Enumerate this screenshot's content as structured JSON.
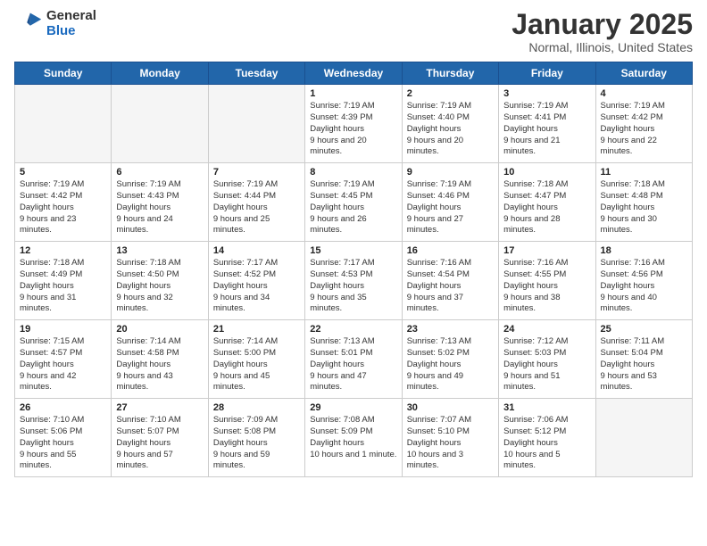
{
  "logo": {
    "general": "General",
    "blue": "Blue"
  },
  "header": {
    "title": "January 2025",
    "subtitle": "Normal, Illinois, United States"
  },
  "days_of_week": [
    "Sunday",
    "Monday",
    "Tuesday",
    "Wednesday",
    "Thursday",
    "Friday",
    "Saturday"
  ],
  "weeks": [
    [
      {
        "day": "",
        "empty": true
      },
      {
        "day": "",
        "empty": true
      },
      {
        "day": "",
        "empty": true
      },
      {
        "day": "1",
        "sunrise": "7:19 AM",
        "sunset": "4:39 PM",
        "daylight": "9 hours and 20 minutes."
      },
      {
        "day": "2",
        "sunrise": "7:19 AM",
        "sunset": "4:40 PM",
        "daylight": "9 hours and 20 minutes."
      },
      {
        "day": "3",
        "sunrise": "7:19 AM",
        "sunset": "4:41 PM",
        "daylight": "9 hours and 21 minutes."
      },
      {
        "day": "4",
        "sunrise": "7:19 AM",
        "sunset": "4:42 PM",
        "daylight": "9 hours and 22 minutes."
      }
    ],
    [
      {
        "day": "5",
        "sunrise": "7:19 AM",
        "sunset": "4:42 PM",
        "daylight": "9 hours and 23 minutes."
      },
      {
        "day": "6",
        "sunrise": "7:19 AM",
        "sunset": "4:43 PM",
        "daylight": "9 hours and 24 minutes."
      },
      {
        "day": "7",
        "sunrise": "7:19 AM",
        "sunset": "4:44 PM",
        "daylight": "9 hours and 25 minutes."
      },
      {
        "day": "8",
        "sunrise": "7:19 AM",
        "sunset": "4:45 PM",
        "daylight": "9 hours and 26 minutes."
      },
      {
        "day": "9",
        "sunrise": "7:19 AM",
        "sunset": "4:46 PM",
        "daylight": "9 hours and 27 minutes."
      },
      {
        "day": "10",
        "sunrise": "7:18 AM",
        "sunset": "4:47 PM",
        "daylight": "9 hours and 28 minutes."
      },
      {
        "day": "11",
        "sunrise": "7:18 AM",
        "sunset": "4:48 PM",
        "daylight": "9 hours and 30 minutes."
      }
    ],
    [
      {
        "day": "12",
        "sunrise": "7:18 AM",
        "sunset": "4:49 PM",
        "daylight": "9 hours and 31 minutes."
      },
      {
        "day": "13",
        "sunrise": "7:18 AM",
        "sunset": "4:50 PM",
        "daylight": "9 hours and 32 minutes."
      },
      {
        "day": "14",
        "sunrise": "7:17 AM",
        "sunset": "4:52 PM",
        "daylight": "9 hours and 34 minutes."
      },
      {
        "day": "15",
        "sunrise": "7:17 AM",
        "sunset": "4:53 PM",
        "daylight": "9 hours and 35 minutes."
      },
      {
        "day": "16",
        "sunrise": "7:16 AM",
        "sunset": "4:54 PM",
        "daylight": "9 hours and 37 minutes."
      },
      {
        "day": "17",
        "sunrise": "7:16 AM",
        "sunset": "4:55 PM",
        "daylight": "9 hours and 38 minutes."
      },
      {
        "day": "18",
        "sunrise": "7:16 AM",
        "sunset": "4:56 PM",
        "daylight": "9 hours and 40 minutes."
      }
    ],
    [
      {
        "day": "19",
        "sunrise": "7:15 AM",
        "sunset": "4:57 PM",
        "daylight": "9 hours and 42 minutes."
      },
      {
        "day": "20",
        "sunrise": "7:14 AM",
        "sunset": "4:58 PM",
        "daylight": "9 hours and 43 minutes."
      },
      {
        "day": "21",
        "sunrise": "7:14 AM",
        "sunset": "5:00 PM",
        "daylight": "9 hours and 45 minutes."
      },
      {
        "day": "22",
        "sunrise": "7:13 AM",
        "sunset": "5:01 PM",
        "daylight": "9 hours and 47 minutes."
      },
      {
        "day": "23",
        "sunrise": "7:13 AM",
        "sunset": "5:02 PM",
        "daylight": "9 hours and 49 minutes."
      },
      {
        "day": "24",
        "sunrise": "7:12 AM",
        "sunset": "5:03 PM",
        "daylight": "9 hours and 51 minutes."
      },
      {
        "day": "25",
        "sunrise": "7:11 AM",
        "sunset": "5:04 PM",
        "daylight": "9 hours and 53 minutes."
      }
    ],
    [
      {
        "day": "26",
        "sunrise": "7:10 AM",
        "sunset": "5:06 PM",
        "daylight": "9 hours and 55 minutes."
      },
      {
        "day": "27",
        "sunrise": "7:10 AM",
        "sunset": "5:07 PM",
        "daylight": "9 hours and 57 minutes."
      },
      {
        "day": "28",
        "sunrise": "7:09 AM",
        "sunset": "5:08 PM",
        "daylight": "9 hours and 59 minutes."
      },
      {
        "day": "29",
        "sunrise": "7:08 AM",
        "sunset": "5:09 PM",
        "daylight": "10 hours and 1 minute."
      },
      {
        "day": "30",
        "sunrise": "7:07 AM",
        "sunset": "5:10 PM",
        "daylight": "10 hours and 3 minutes."
      },
      {
        "day": "31",
        "sunrise": "7:06 AM",
        "sunset": "5:12 PM",
        "daylight": "10 hours and 5 minutes."
      },
      {
        "day": "",
        "empty": true
      }
    ]
  ],
  "labels": {
    "sunrise": "Sunrise:",
    "sunset": "Sunset:",
    "daylight": "Daylight hours"
  }
}
